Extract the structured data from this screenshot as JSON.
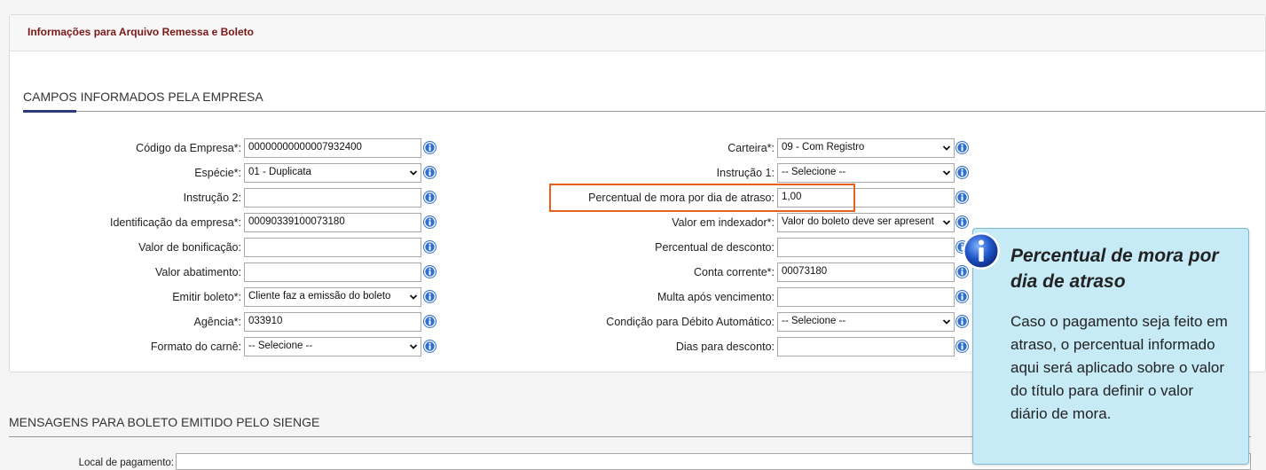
{
  "panel": {
    "title": "Informações para Arquivo Remessa e Boleto",
    "section_title": "CAMPOS INFORMADOS PELA EMPRESA"
  },
  "left_fields": [
    {
      "label": "Código da Empresa*:",
      "value": "00000000000007932400",
      "type": "text"
    },
    {
      "label": "Espécie*:",
      "value": "01 - Duplicata",
      "type": "select"
    },
    {
      "label": "Instrução 2:",
      "value": "",
      "type": "text"
    },
    {
      "label": "Identificação da empresa*:",
      "value": "00090339100073180",
      "type": "text"
    },
    {
      "label": "Valor de bonificação:",
      "value": "",
      "type": "text"
    },
    {
      "label": "Valor abatimento:",
      "value": "",
      "type": "text"
    },
    {
      "label": "Emitir boleto*:",
      "value": "Cliente faz a emissão do boleto",
      "type": "select"
    },
    {
      "label": "Agência*:",
      "value": "033910",
      "type": "text"
    },
    {
      "label": "Formato do carnê:",
      "value": "-- Selecione --",
      "type": "select"
    }
  ],
  "right_fields": [
    {
      "label": "Carteira*:",
      "value": "09 - Com Registro",
      "type": "select"
    },
    {
      "label": "Instrução 1:",
      "value": "-- Selecione --",
      "type": "select"
    },
    {
      "label": "Percentual de mora por dia de atraso:",
      "value": "1,00",
      "type": "text"
    },
    {
      "label": "Valor em indexador*:",
      "value": "Valor do boleto deve ser apresent",
      "type": "select"
    },
    {
      "label": "Percentual de desconto:",
      "value": "",
      "type": "text"
    },
    {
      "label": "Conta corrente*:",
      "value": "00073180",
      "type": "text"
    },
    {
      "label": "Multa após vencimento:",
      "value": "",
      "type": "text"
    },
    {
      "label": "Condição para Débito Automático:",
      "value": "-- Selecione --",
      "type": "select"
    },
    {
      "label": "Dias para desconto:",
      "value": "",
      "type": "text"
    }
  ],
  "messages": {
    "section_title": "MENSAGENS PARA BOLETO EMITIDO PELO SIENGE",
    "local_pagamento_label": "Local de pagamento:",
    "local_pagamento_value": ""
  },
  "tooltip": {
    "title": "Percentual de mora por dia de atraso",
    "body": "Caso o pagamento seja feito em atraso, o percentual informado aqui será aplicado sobre o valor do título para definir o valor diário de mora."
  },
  "colors": {
    "panel_title": "#7a1818",
    "section_accent": "#2a3a7a",
    "highlight_border": "#e8601c",
    "tooltip_bg": "#c6eaf6",
    "info_icon": "#2f6fd0"
  },
  "icons": {
    "field_help": "info-icon",
    "dropdown": "chevron-down-icon",
    "tooltip": "info-icon"
  }
}
